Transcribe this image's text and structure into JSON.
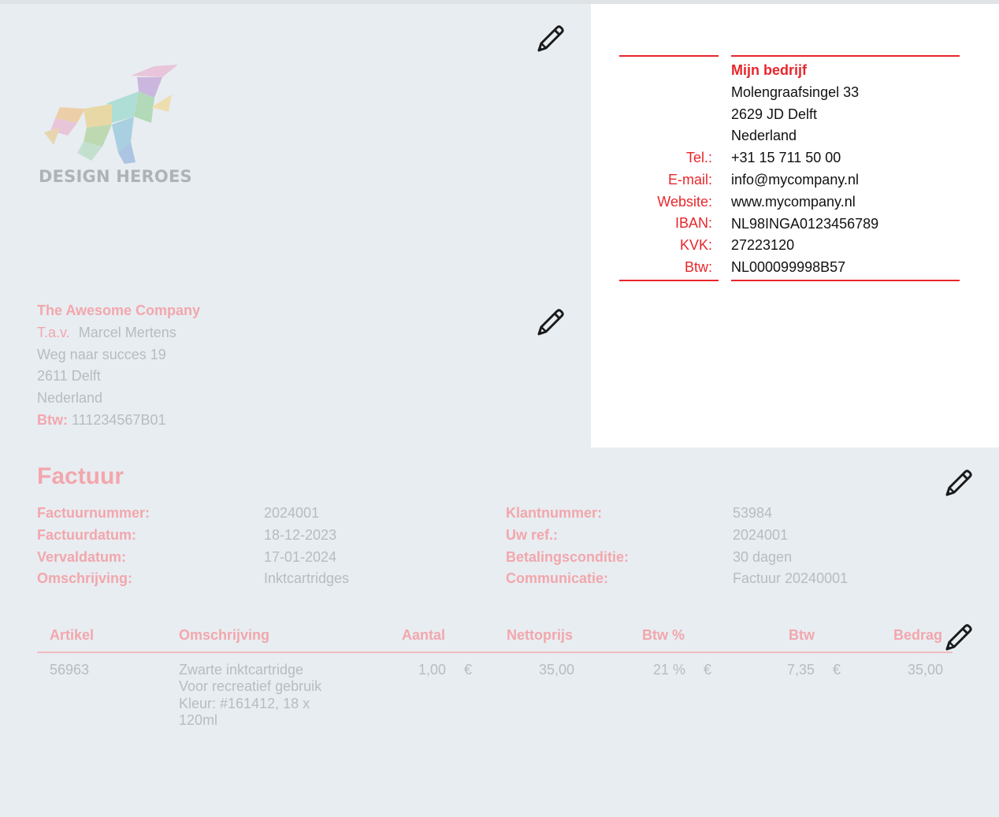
{
  "logo": {
    "text": "DESIGN HEROES"
  },
  "customer": {
    "name": "The Awesome Company",
    "attn_label": "T.a.v.",
    "attn_name": "Marcel Mertens",
    "street": "Weg naar succes 19",
    "city": "2611 Delft",
    "country": "Nederland",
    "vat_label": "Btw:",
    "vat_value": "111234567B01"
  },
  "company": {
    "name": "Mijn bedrijf",
    "street": "Molengraafsingel 33",
    "city": "2629 JD Delft",
    "country": "Nederland",
    "contacts": [
      {
        "label": "Tel.:",
        "value": "+31 15 711 50 00"
      },
      {
        "label": "E-mail:",
        "value": "info@mycompany.nl"
      },
      {
        "label": "Website:",
        "value": "www.mycompany.nl"
      },
      {
        "label": "IBAN:",
        "value": "NL98INGA0123456789"
      },
      {
        "label": "KVK:",
        "value": "27223120"
      },
      {
        "label": "Btw:",
        "value": "NL000099998B57"
      }
    ]
  },
  "invoice": {
    "title": "Factuur",
    "left": [
      {
        "label": "Factuurnummer:",
        "value": "2024001"
      },
      {
        "label": "Factuurdatum:",
        "value": "18-12-2023"
      },
      {
        "label": "Vervaldatum:",
        "value": "17-01-2024"
      },
      {
        "label": "Omschrijving:",
        "value": "Inktcartridges"
      }
    ],
    "right": [
      {
        "label": "Klantnummer:",
        "value": "53984"
      },
      {
        "label": "Uw ref.:",
        "value": "2024001"
      },
      {
        "label": "Betalingsconditie:",
        "value": "30 dagen"
      },
      {
        "label": "Communicatie:",
        "value": "Factuur 20240001"
      }
    ]
  },
  "table": {
    "headers": {
      "artikel": "Artikel",
      "omschrijving": "Omschrijving",
      "aantal": "Aantal",
      "nettoprijs": "Nettoprijs",
      "btw_pct": "Btw %",
      "btw": "Btw",
      "bedrag": "Bedrag"
    },
    "rows": [
      {
        "artikel": "56963",
        "omschrijving": [
          "Zwarte inktcartridge",
          "Voor recreatief gebruik",
          "Kleur: #161412, 18 x",
          "120ml"
        ],
        "aantal": "1,00",
        "currency": "€",
        "nettoprijs": "35,00",
        "btw_pct": "21 %",
        "btw": "7,35",
        "bedrag": "35,00"
      }
    ]
  },
  "colors": {
    "accent": "#e8262b",
    "faded_accent": "#f2a7ad",
    "faded_text": "#b7bcc1",
    "background": "#e8edf1",
    "panel": "#ffffff"
  },
  "icons": [
    "pencil-icon"
  ]
}
